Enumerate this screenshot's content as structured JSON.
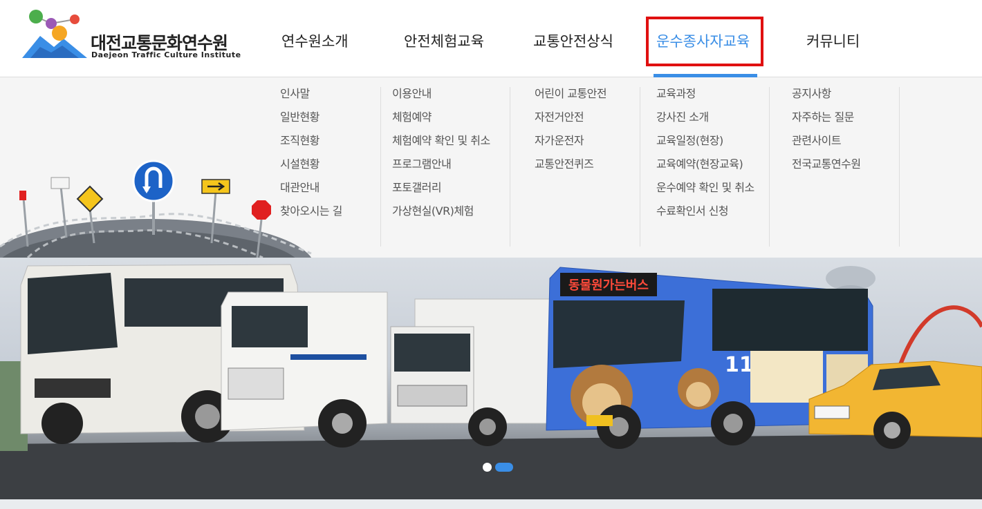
{
  "site": {
    "name_kr": "대전교통문화연수원",
    "name_en": "Daejeon Traffic Culture Institute"
  },
  "nav": {
    "items": [
      {
        "label": "연수원소개"
      },
      {
        "label": "안전체험교육"
      },
      {
        "label": "교통안전상식"
      },
      {
        "label": "운수종사자교육"
      },
      {
        "label": "커뮤니티"
      }
    ],
    "active_index": 3,
    "accent_color": "#3a8ee6",
    "highlight_color": "#e01010"
  },
  "submenu": {
    "columns": [
      {
        "items": [
          "인사말",
          "일반현황",
          "조직현황",
          "시설현황",
          "대관안내",
          "찾아오시는 길"
        ]
      },
      {
        "items": [
          "이용안내",
          "체험예약",
          "체험예약 확인 및 취소",
          "프로그램안내",
          "포토갤러리",
          "가상현실(VR)체험"
        ]
      },
      {
        "items": [
          "어린이 교통안전",
          "자전거안전",
          "자가운전자",
          "교통안전퀴즈"
        ]
      },
      {
        "items": [
          "교육과정",
          "강사진 소개",
          "교육일정(현장)",
          "교육예약(현장교육)",
          "운수예약 확인 및 취소",
          "수료확인서 신청"
        ]
      },
      {
        "items": [
          "공지사항",
          "자주하는 질문",
          "관련사이트",
          "전국교통연수원"
        ]
      }
    ]
  },
  "banner": {
    "bus_sign": "동물원가는버스",
    "bus_number": "115",
    "slides": 2,
    "active_slide": 2
  }
}
